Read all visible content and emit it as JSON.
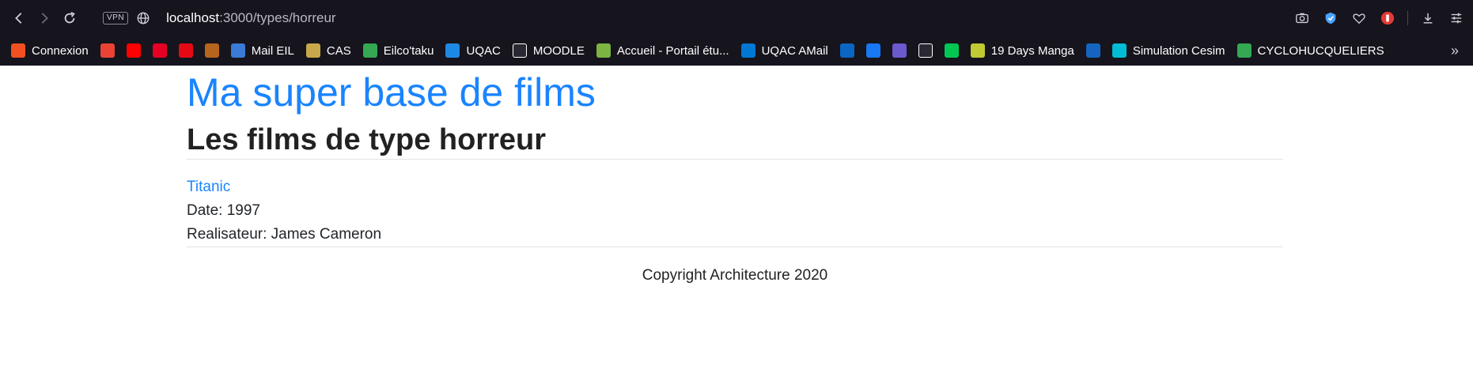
{
  "browser": {
    "vpn_label": "VPN",
    "url_host": "localhost",
    "url_path": ":3000/types/horreur"
  },
  "bookmarks": [
    {
      "label": "Connexion",
      "icon": "microsoft-icon",
      "color": "#f25022"
    },
    {
      "label": "",
      "icon": "gmail-icon",
      "color": "#ea4335"
    },
    {
      "label": "",
      "icon": "youtube-icon",
      "color": "#ff0000"
    },
    {
      "label": "",
      "icon": "pinterest-icon",
      "color": "#e60023"
    },
    {
      "label": "",
      "icon": "netflix-icon",
      "color": "#e50914"
    },
    {
      "label": "",
      "icon": "seal-icon",
      "color": "#b5651d"
    },
    {
      "label": "Mail EIL",
      "icon": "mail-eil-icon",
      "color": "#3a7bd5"
    },
    {
      "label": "CAS",
      "icon": "cas-icon",
      "color": "#c8a84b"
    },
    {
      "label": "Eilco'taku",
      "icon": "google-drive-icon",
      "color": "#34a853"
    },
    {
      "label": "UQAC",
      "icon": "uqac-icon",
      "color": "#1e88e5"
    },
    {
      "label": "MOODLE",
      "icon": "moodle-icon",
      "color": "#ffffff"
    },
    {
      "label": "Accueil - Portail étu...",
      "icon": "uqac-portal-icon",
      "color": "#7cb342"
    },
    {
      "label": "UQAC AMail",
      "icon": "outlook-icon",
      "color": "#0078d4"
    },
    {
      "label": "",
      "icon": "linkedin-icon",
      "color": "#0a66c2"
    },
    {
      "label": "",
      "icon": "facebook-icon",
      "color": "#1877f2"
    },
    {
      "label": "",
      "icon": "wr-icon",
      "color": "#6a5acd"
    },
    {
      "label": "",
      "icon": "s-icon",
      "color": "#ffffff"
    },
    {
      "label": "",
      "icon": "check-icon",
      "color": "#00c853"
    },
    {
      "label": "19 Days Manga",
      "icon": "manga-icon",
      "color": "#c0ca33"
    },
    {
      "label": "",
      "icon": "robot-icon",
      "color": "#1565c0"
    },
    {
      "label": "Simulation Cesim",
      "icon": "cesim-icon",
      "color": "#00bcd4"
    },
    {
      "label": "CYCLOHUCQUELIERS",
      "icon": "google-drive-icon",
      "color": "#34a853"
    }
  ],
  "page": {
    "site_title": "Ma super base de films",
    "heading": "Les films de type horreur",
    "film": {
      "title": "Titanic",
      "date": "Date: 1997",
      "director": "Realisateur: James Cameron"
    },
    "footer": "Copyright Architecture 2020"
  },
  "colors": {
    "chrome_bg": "#16141d",
    "link_blue": "#1a84ff"
  }
}
